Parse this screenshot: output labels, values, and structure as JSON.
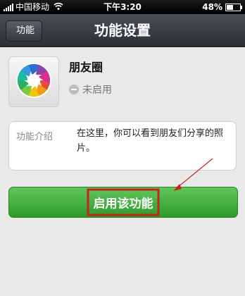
{
  "status_bar": {
    "carrier": "中国移动",
    "time": "下午3:20",
    "battery": "48%",
    "battery_level": 0.48
  },
  "nav": {
    "back_label": "功能",
    "title": "功能设置"
  },
  "feature": {
    "name": "朋友圈",
    "status": "未启用",
    "icon": "aperture-icon"
  },
  "intro": {
    "label": "功能介绍",
    "text": "在这里，你可以看到朋友们分享的照片。"
  },
  "enable_button": {
    "label": "启用该功能"
  },
  "colors": {
    "accent_green": "#3fae38",
    "annotation_red": "#cc2020",
    "nav_dark": "#2b2f33"
  }
}
